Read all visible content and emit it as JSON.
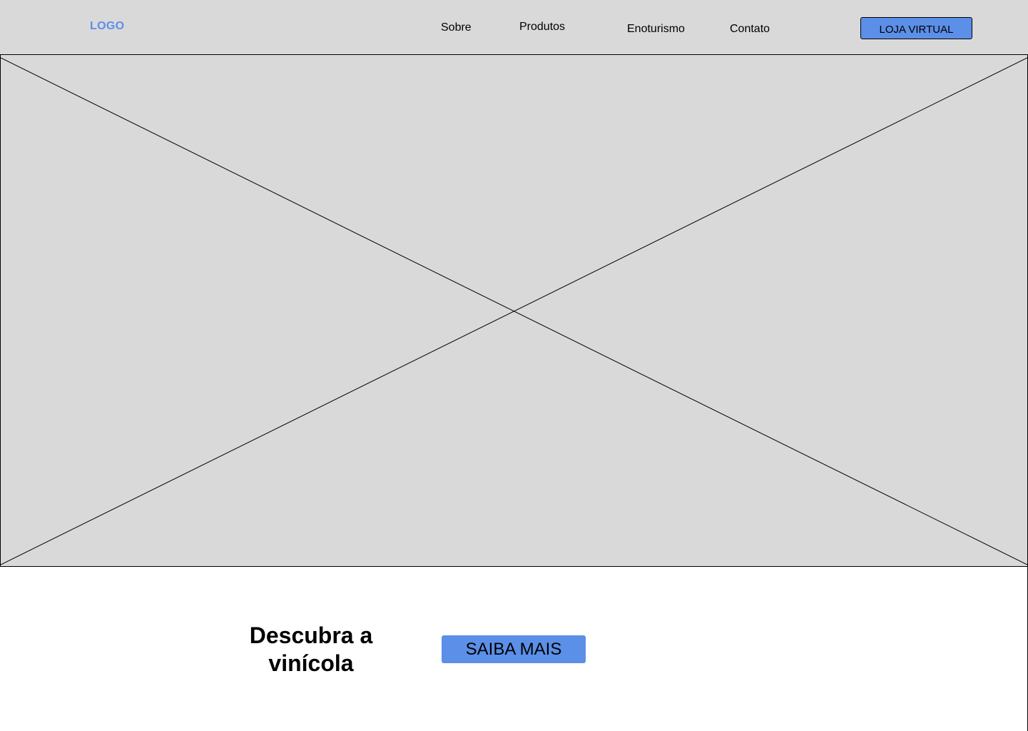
{
  "header": {
    "logo": "LOGO",
    "nav": {
      "sobre": "Sobre",
      "produtos": "Produtos",
      "enoturismo": "Enoturismo",
      "contato": "Contato"
    },
    "store_button": "LOJA VIRTUAL"
  },
  "hero": {
    "image_placeholder": "image-placeholder"
  },
  "cta": {
    "title_line1": "Descubra a",
    "title_line2": "vinícola",
    "button": "SAIBA MAIS"
  },
  "colors": {
    "accent": "#5b8fe8",
    "header_bg": "#d9d9d9",
    "placeholder_bg": "#d9d9d9"
  }
}
